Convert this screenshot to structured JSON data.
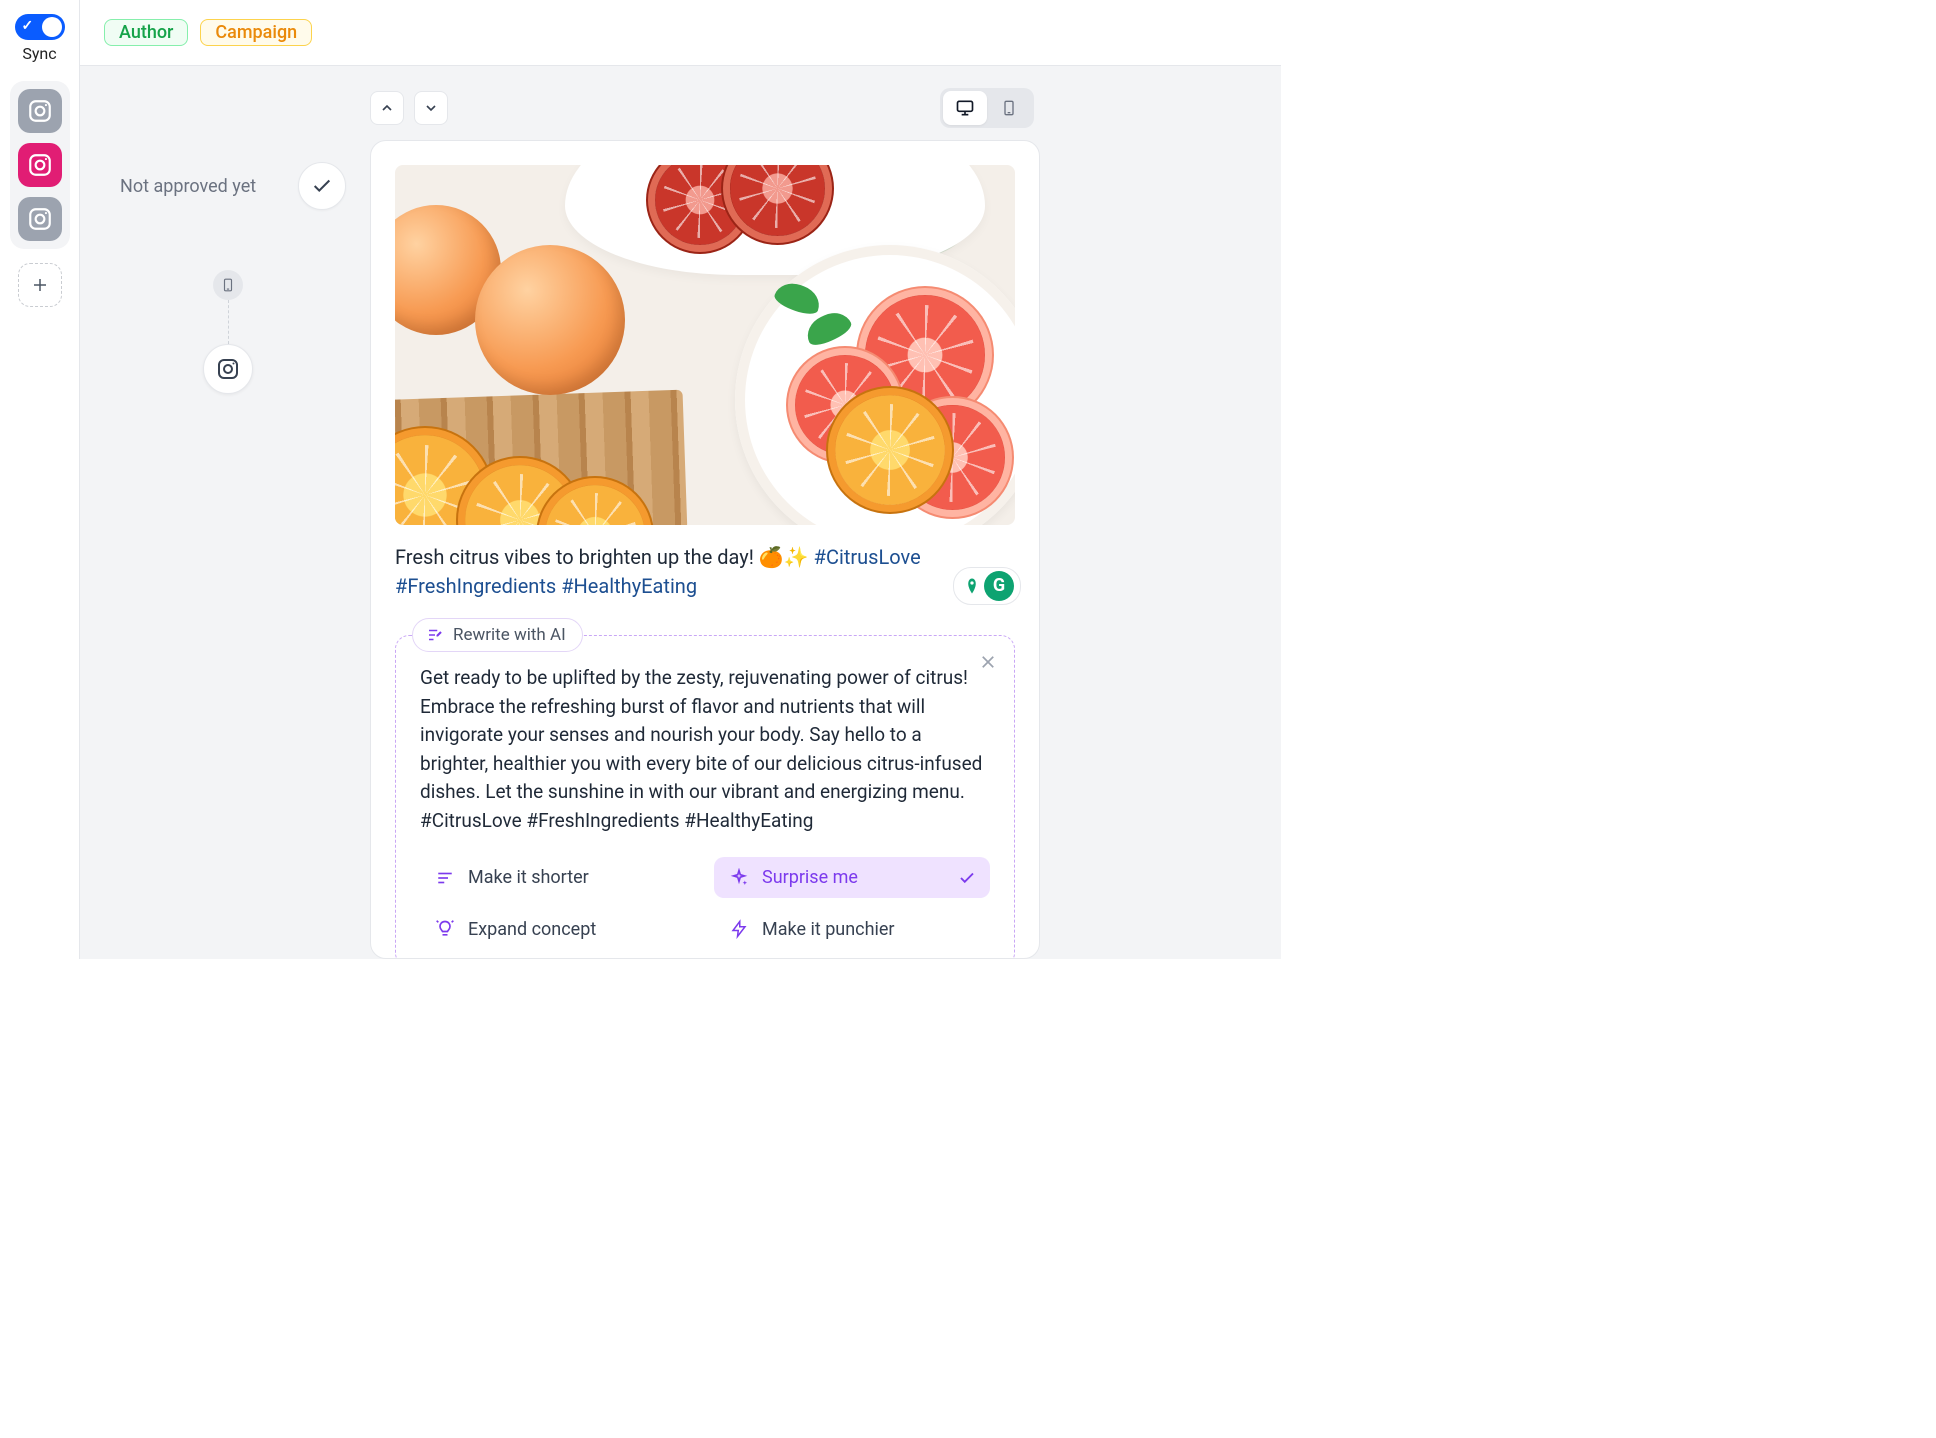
{
  "leftRail": {
    "syncLabel": "Sync",
    "syncOn": true
  },
  "topbar": {
    "tags": [
      {
        "label": "Author",
        "style": "green"
      },
      {
        "label": "Campaign",
        "style": "orange"
      }
    ]
  },
  "approval": {
    "status": "Not approved yet"
  },
  "post": {
    "caption_text": "Fresh citrus vibes to brighten up the day! ",
    "caption_emoji": "🍊✨ ",
    "hashtags": [
      "#CitrusLove",
      "#FreshIngredients",
      "#HealthyEating"
    ]
  },
  "ai": {
    "pill": "Rewrite with AI",
    "body": "Get ready to be uplifted by the zesty, rejuvenating power of citrus! Embrace the refreshing burst of flavor and nutrients that will invigorate your senses and nourish your body. Say hello to a brighter, healthier you with every bite of our delicious citrus-infused dishes. Let the sunshine in with our vibrant and energizing menu. #CitrusLove #FreshIngredients #HealthyEating",
    "actions": {
      "shorter": "Make it shorter",
      "surprise": "Surprise me",
      "expand": "Expand concept",
      "punchier": "Make it punchier"
    },
    "selected": "surprise"
  }
}
